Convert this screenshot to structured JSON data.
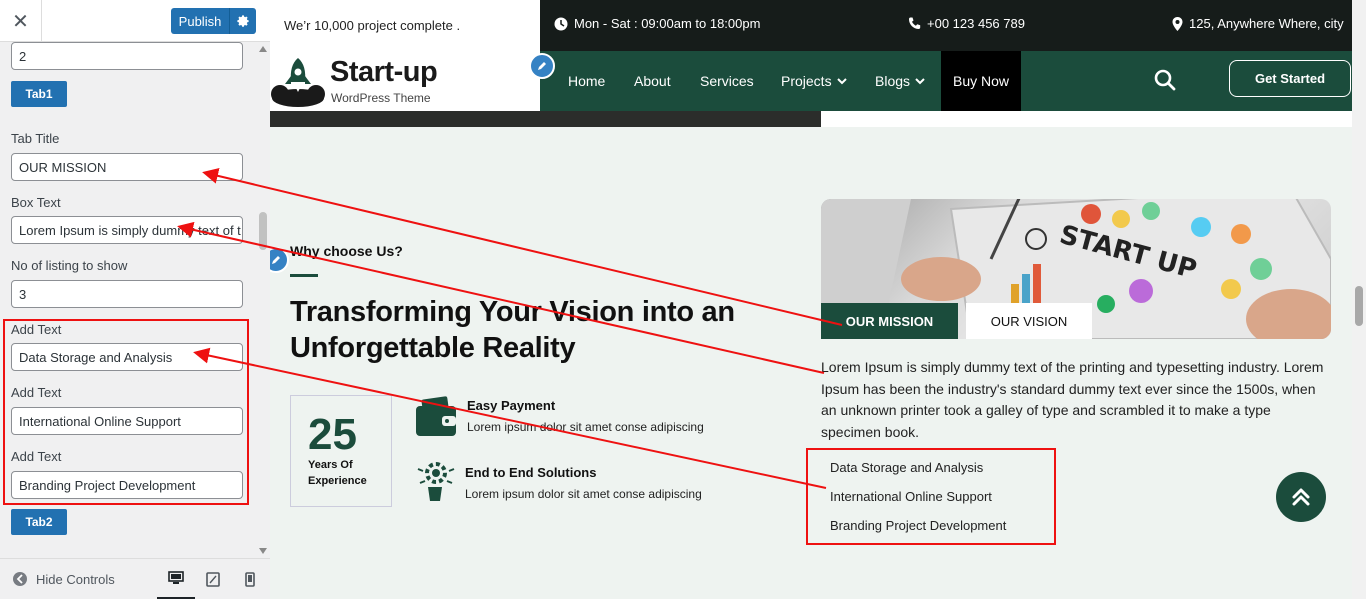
{
  "sidebar": {
    "publish_label": "Publish",
    "first_input_value": "2",
    "tab1_label": "Tab1",
    "tab_title_label": "Tab Title",
    "tab_title_value": "OUR MISSION",
    "box_text_label": "Box Text",
    "box_text_value": "Lorem Ipsum is simply dummy text of t",
    "listing_label": "No of listing to show",
    "listing_value": "3",
    "add_text_label": "Add Text",
    "add_text_1": "Data Storage and Analysis",
    "add_text_2": "International Online Support",
    "add_text_3": "Branding Project Development",
    "tab2_label": "Tab2",
    "hide_controls_label": "Hide Controls"
  },
  "preview": {
    "topbar": {
      "tagline": "We’r 10,000 project complete .",
      "hours": "Mon - Sat : 09:00am to 18:00pm",
      "phone": "+00 123 456 789",
      "address": "125, Anywhere Where, city"
    },
    "logo": {
      "title": "Start-up",
      "subtitle": "WordPress Theme"
    },
    "nav": {
      "home": "Home",
      "about": "About",
      "services": "Services",
      "projects": "Projects",
      "blogs": "Blogs",
      "buy_now": "Buy Now",
      "get_started": "Get Started"
    },
    "section": {
      "eyebrow": "Why choose Us?",
      "headline": "Transforming Your Vision into an Unforgettable Reality",
      "years_number": "25",
      "years_text": "Years Of Experience",
      "feature1_title": "Easy Payment",
      "feature1_text": "Lorem ipsum dolor sit amet conse adipiscing",
      "feature2_title": "End to End Solutions",
      "feature2_text": "Lorem ipsum dolor sit amet conse adipiscing"
    },
    "tabs": {
      "mission": "OUR MISSION",
      "vision": "OUR VISION"
    },
    "mission_paragraph": "Lorem Ipsum is simply dummy text of the printing and typesetting industry. Lorem Ipsum has been the industry's standard dummy text ever since the 1500s, when an unknown printer took a galley of type and scrambled it to make a type specimen book.",
    "mission_list": [
      "Data Storage and Analysis",
      "International Online Support",
      "Branding Project Development"
    ],
    "image_text": "START UP"
  },
  "colors": {
    "brand_green": "#1b4c3c",
    "wp_blue": "#2271b1",
    "annotation_red": "#e11111",
    "topbar_dark": "#161c1a"
  },
  "icons": [
    "close-icon",
    "gear-icon",
    "clock-icon",
    "phone-icon",
    "location-pin-icon",
    "rocket-logo-icon",
    "chevron-down-icon",
    "search-icon",
    "pencil-icon",
    "wallet-icon",
    "hand-gear-icon",
    "double-chevron-up-icon",
    "eye-icon",
    "desktop-icon",
    "tablet-icon",
    "mobile-icon"
  ]
}
